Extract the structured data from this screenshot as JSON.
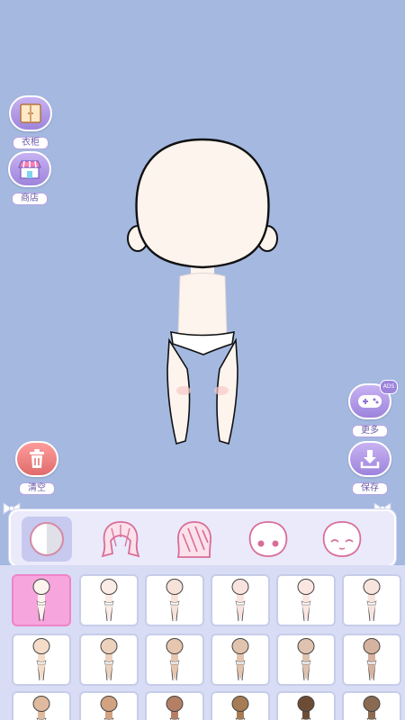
{
  "sidebar": {
    "wardrobe_label": "衣柜",
    "shop_label": "商店",
    "clear_label": "清空",
    "more_label": "更多",
    "more_badge": "ADS",
    "save_label": "保存"
  },
  "category_tabs": [
    {
      "name": "skin",
      "icon": "skin-tone-icon",
      "selected": true
    },
    {
      "name": "back-hair",
      "icon": "back-hair-icon",
      "selected": false
    },
    {
      "name": "front-hair",
      "icon": "front-hair-icon",
      "selected": false
    },
    {
      "name": "eyes",
      "icon": "face-eyes-icon",
      "selected": false
    },
    {
      "name": "expression",
      "icon": "face-expression-icon",
      "selected": false
    }
  ],
  "skin_options": [
    {
      "color": "#fdf4ee",
      "selected": true
    },
    {
      "color": "#fbece6"
    },
    {
      "color": "#f6e2d8"
    },
    {
      "color": "#f9e3de"
    },
    {
      "color": "#fbe6e2"
    },
    {
      "color": "#f6e4dd"
    },
    {
      "color": "#f4dcc8"
    },
    {
      "color": "#ecd1bc"
    },
    {
      "color": "#e6c6ae"
    },
    {
      "color": "#e2c4ae"
    },
    {
      "color": "#dfc2b0"
    },
    {
      "color": "#d6b3a0"
    },
    {
      "color": "#e0ba9e"
    },
    {
      "color": "#d1a381"
    },
    {
      "color": "#b47f65"
    },
    {
      "color": "#a67c55"
    },
    {
      "color": "#6d4c36"
    },
    {
      "color": "#8a6a52"
    }
  ],
  "colors": {
    "background": "#a4b8e0",
    "accent_purple": "#a68ae0",
    "selected_pink": "#f7a6dd"
  }
}
